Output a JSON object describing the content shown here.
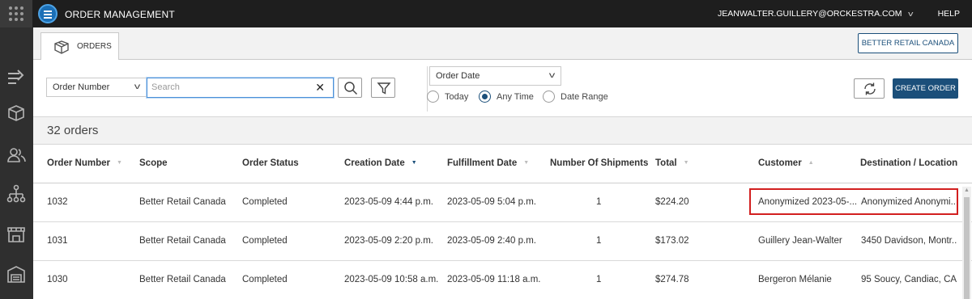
{
  "topbar": {
    "app_title": "ORDER MANAGEMENT",
    "user": "JEANWALTER.GUILLERY@ORCKESTRA.COM",
    "help": "HELP"
  },
  "leftnav": {
    "items": [
      "arrow-right-icon",
      "package-icon",
      "customers-icon",
      "organization-icon",
      "store-icon",
      "inventory-icon"
    ]
  },
  "tabs": [
    {
      "label": "ORDERS",
      "icon": "package-icon",
      "active": true
    }
  ],
  "scope_button": "BETTER RETAIL CANADA",
  "filters": {
    "field_select": "Order Number",
    "search_placeholder": "Search",
    "date_field_select": "Order Date",
    "date_options": [
      {
        "label": "Today",
        "selected": false
      },
      {
        "label": "Any Time",
        "selected": true
      },
      {
        "label": "Date Range",
        "selected": false
      }
    ],
    "create_button": "CREATE ORDER"
  },
  "results": {
    "count_label": "32 orders"
  },
  "table": {
    "columns": [
      {
        "label": "Order Number",
        "sort": "none"
      },
      {
        "label": "Scope",
        "sort": null
      },
      {
        "label": "Order Status",
        "sort": null
      },
      {
        "label": "Creation Date",
        "sort": "descending-active"
      },
      {
        "label": "Fulfillment Date",
        "sort": "none"
      },
      {
        "label": "Number Of Shipments",
        "sort": null
      },
      {
        "label": "Total",
        "sort": "none"
      },
      {
        "label": "Customer",
        "sort": "ascending"
      },
      {
        "label": "Destination / Location",
        "sort": null
      }
    ],
    "rows": [
      {
        "order_number": "1032",
        "scope": "Better Retail Canada",
        "status": "Completed",
        "creation_date": "2023-05-09 4:44 p.m.",
        "fulfillment_date": "2023-05-09 5:04 p.m.",
        "shipments": "1",
        "total": "$224.20",
        "customer": "Anonymized 2023-05-...",
        "destination": "Anonymized Anonymi..."
      },
      {
        "order_number": "1031",
        "scope": "Better Retail Canada",
        "status": "Completed",
        "creation_date": "2023-05-09 2:20 p.m.",
        "fulfillment_date": "2023-05-09 2:40 p.m.",
        "shipments": "1",
        "total": "$173.02",
        "customer": "Guillery Jean-Walter",
        "destination": "3450 Davidson, Montr..."
      },
      {
        "order_number": "1030",
        "scope": "Better Retail Canada",
        "status": "Completed",
        "creation_date": "2023-05-09 10:58 a.m.",
        "fulfillment_date": "2023-05-09 11:18 a.m.",
        "shipments": "1",
        "total": "$274.78",
        "customer": "Bergeron Mélanie",
        "destination": "95 Soucy, Candiac, CA..."
      }
    ]
  },
  "colors": {
    "topbar": "#1e1e1e",
    "leftnav": "#2f2f2f",
    "primary": "#1b4f7a",
    "highlight_border": "#d21f1f"
  }
}
